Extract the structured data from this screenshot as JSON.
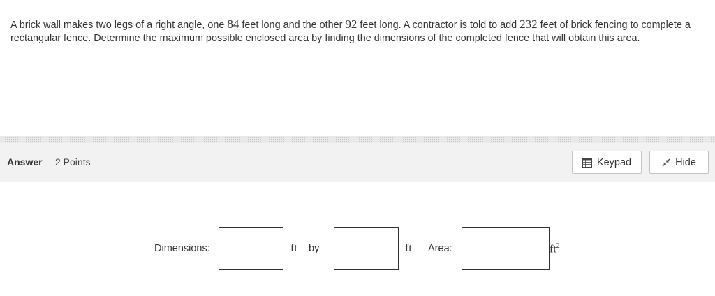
{
  "question": {
    "t1": "A brick wall makes two legs of a right angle, one ",
    "leg1": "84",
    "t2": " feet long and the other ",
    "leg2": "92",
    "t3": " feet long. A contractor is told to add ",
    "fence": "232",
    "t4": " feet of brick fencing to complete a rectangular fence. Determine the maximum possible enclosed area by finding the dimensions of the completed fence that will obtain this area."
  },
  "answer_bar": {
    "label": "Answer",
    "points": "2 Points",
    "keypad_label": "Keypad",
    "hide_label": "Hide"
  },
  "form": {
    "dimensions_label": "Dimensions:",
    "dim1_value": "",
    "unit_ft_1": "ft",
    "by_label": "by",
    "dim2_value": "",
    "unit_ft_2": "ft",
    "area_label": "Area:",
    "area_value": "",
    "area_unit_base": "ft",
    "area_unit_exp": "2"
  },
  "icons": {
    "keypad": "keypad-grid-icon",
    "hide": "collapse-arrows-icon"
  }
}
